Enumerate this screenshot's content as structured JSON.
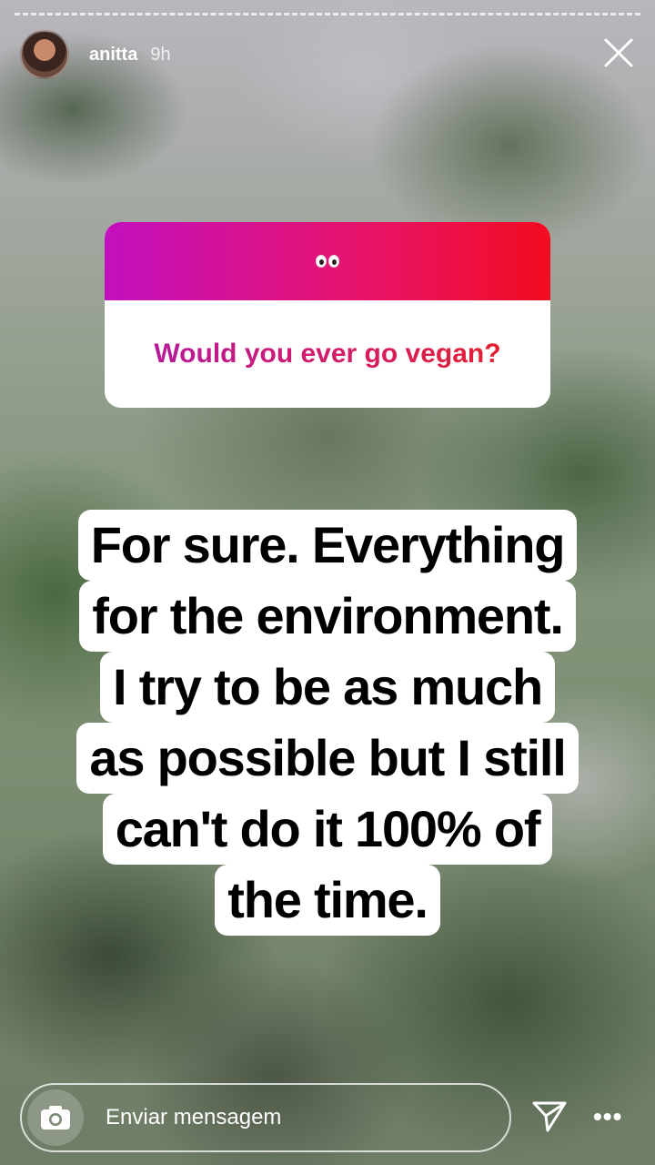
{
  "story": {
    "username": "anitta",
    "time_ago": "9h"
  },
  "question_sticker": {
    "emoji": "👀",
    "question": "Would you ever go vegan?"
  },
  "answer": {
    "lines": [
      "For sure. Everything",
      "for the environment.",
      "I try to be as much",
      "as possible but I still",
      "can't do it 100% of",
      "the time."
    ]
  },
  "footer": {
    "message_placeholder": "Enviar mensagem"
  },
  "icons": {
    "close": "close-icon",
    "camera": "camera-icon",
    "send": "send-icon",
    "more": "more-options-icon"
  }
}
